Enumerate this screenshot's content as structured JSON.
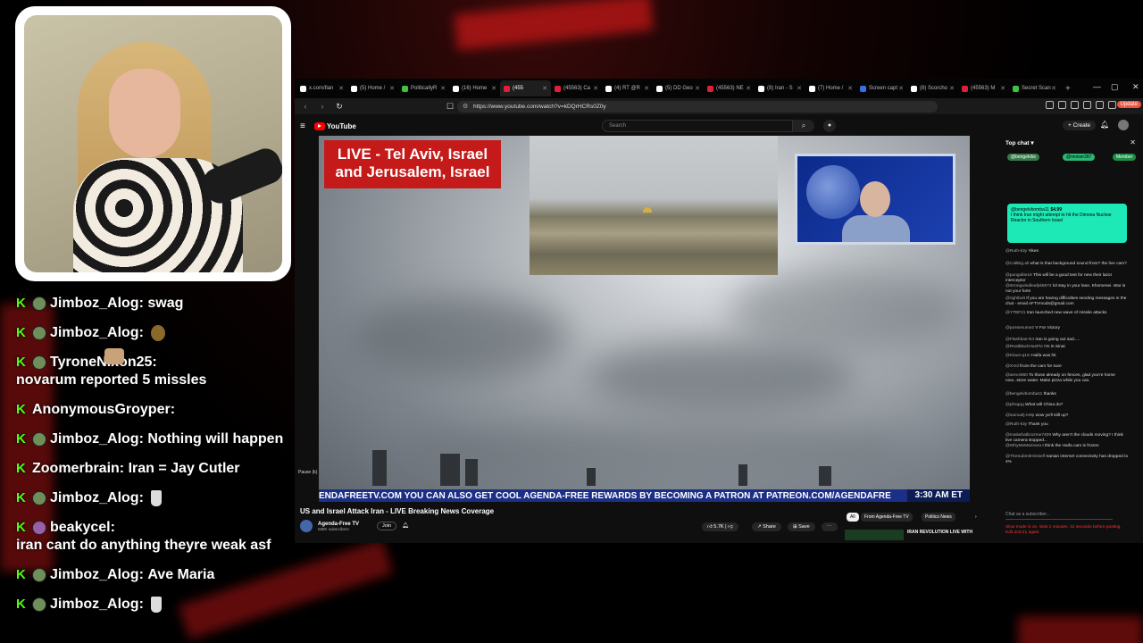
{
  "stream_chat": [
    {
      "user": "Jimboz_Alog",
      "text": "swag",
      "avatar": true,
      "emote": ""
    },
    {
      "user": "Jimboz_Alog",
      "text": "",
      "avatar": true,
      "emote": "ball"
    },
    {
      "user": "TyroneNixon25",
      "text": "novarum reported 5 missles",
      "avatar": true,
      "emote": ""
    },
    {
      "user": "AnonymousGroyper",
      "text": "",
      "avatar": false,
      "emote": "face"
    },
    {
      "user": "Jimboz_Alog",
      "text": "Nothing will happen",
      "avatar": true,
      "emote": ""
    },
    {
      "user": "Zoomerbrain",
      "text": "Iran = Jay Cutler",
      "avatar": false,
      "emote": ""
    },
    {
      "user": "Jimboz_Alog",
      "text": "",
      "avatar": true,
      "emote": "coffee"
    },
    {
      "user": "beakycel",
      "text": "iran cant do anything theyre weak asf",
      "avatar": true,
      "emote": ""
    },
    {
      "user": "Jimboz_Alog",
      "text": "Ave Maria",
      "avatar": true,
      "emote": ""
    },
    {
      "user": "Jimboz_Alog",
      "text": "",
      "avatar": true,
      "emote": "coffee"
    }
  ],
  "browser": {
    "tabs": [
      {
        "label": "x.com/Ilan",
        "color": "#ffffff"
      },
      {
        "label": "(5) Home /",
        "color": "#ffffff"
      },
      {
        "label": "PoliticallyR",
        "color": "#3ec43e"
      },
      {
        "label": "(16) Home",
        "color": "#ffffff"
      },
      {
        "label": "(455",
        "color": "#e0203a"
      },
      {
        "label": "(45563) Ca",
        "color": "#e0203a"
      },
      {
        "label": "(4) RT @R",
        "color": "#ffffff"
      },
      {
        "label": "(5) DD Geo",
        "color": "#ffffff"
      },
      {
        "label": "(45563) NE",
        "color": "#e0203a"
      },
      {
        "label": "(8) Iran - S",
        "color": "#ffffff"
      },
      {
        "label": "(7) Home /",
        "color": "#ffffff"
      },
      {
        "label": "Screen capt",
        "color": "#3a6ee8"
      },
      {
        "label": "(8) Scorcho",
        "color": "#ffffff"
      },
      {
        "label": "(45563) M",
        "color": "#e0203a"
      },
      {
        "label": "Secret Scan",
        "color": "#3ec43e"
      }
    ],
    "url": "https://www.youtube.com/watch?v=kDQrHCRs0Z0y",
    "update_label": "Update"
  },
  "youtube": {
    "logo": "YouTube",
    "search_placeholder": "Search",
    "create_label": "+ Create",
    "video": {
      "banner": "LIVE - Tel Aviv, Israel and Jerusalem, Israel",
      "ticker": "ENDAFREETV.COM     YOU CAN ALSO GET COOL AGENDA-FREE REWARDS BY BECOMING A PATRON AT PATREON.COM/AGENDAFRE",
      "time": "3:30 AM ET",
      "pause": "Pause (k)"
    },
    "title": "US and Israel Attack Iran - LIVE Breaking News Coverage",
    "channel": {
      "name": "Agenda-Free TV",
      "subs": "588K subscribers",
      "join": "Join"
    },
    "actions": {
      "likes": "5.7K",
      "share": "Share",
      "save": "Save"
    },
    "chips": [
      "All",
      "From Agenda-Free TV",
      "Politics News"
    ],
    "recommended_title": "IRAN REVOLUTION LIVE WITH"
  },
  "live_chat": {
    "header": "Top chat",
    "pinned": [
      "@bengelvbs",
      "@moiser287",
      "Member"
    ],
    "input_placeholder": "Chat as a subscriber...",
    "superchat": {
      "user": "@bengelvbomba11",
      "amount": "$4.99",
      "text": "I think Iran might attempt to hit the Dimona Nuclear Reactor in Southern Israel"
    },
    "messages": [
      {
        "user": "@Ruth-k3y",
        "text": "Yikes"
      },
      {
        "user": "@CallBig.ali",
        "text": "what is that background sound from? the live cam?"
      },
      {
        "user": "@pungolite18",
        "text": "This will be a good test for new their lazor interceptor"
      },
      {
        "user": "@strongwindleafpk5874",
        "text": "lol stay in your lane, Khomenei. War is not your forte"
      },
      {
        "user": "@rightbolt",
        "text": "If you are having difficulties sending messages in the chat - email AFTVmods@gmail.com"
      },
      {
        "user": "@YTBF21",
        "text": "Iran launched new wave of missile attacks"
      },
      {
        "user": "@possesume2",
        "text": "V For Victory"
      },
      {
        "user": "@Flashbas-N4",
        "text": "Iran is going out sad....."
      },
      {
        "user": "@RealBlackHasPie",
        "text": "I'm in Sinai"
      },
      {
        "user": "@Klaus-q1m",
        "text": "Haifa was hit"
      },
      {
        "user": "@XVol",
        "text": "froze the cam for sure"
      },
      {
        "user": "@arev4060",
        "text": "To those already on fences, glad you're home now...store water. Make pizza while you can."
      },
      {
        "user": "@bengelvbomba11",
        "text": "thanks"
      },
      {
        "user": "@phsqqq",
        "text": "What will China do?"
      },
      {
        "user": "@samuelj-m9p",
        "text": "wow ya'll still up?"
      },
      {
        "user": "@Ruth-k3y",
        "text": "Thank you"
      },
      {
        "user": "@matiwhatlizozme7409",
        "text": "Why aren't the clouds moving? I think live camera stopped..."
      },
      {
        "user": "@WhyMeMarinara",
        "text": "I think the Haifa cam is frozen"
      },
      {
        "user": "@TheSubmitHimself",
        "text": "Iranian internet connectivity has dropped to 4%"
      }
    ],
    "notice": "Slow mode is on. Wait 2 minutes, 31 seconds before posting. Edit and try again."
  }
}
